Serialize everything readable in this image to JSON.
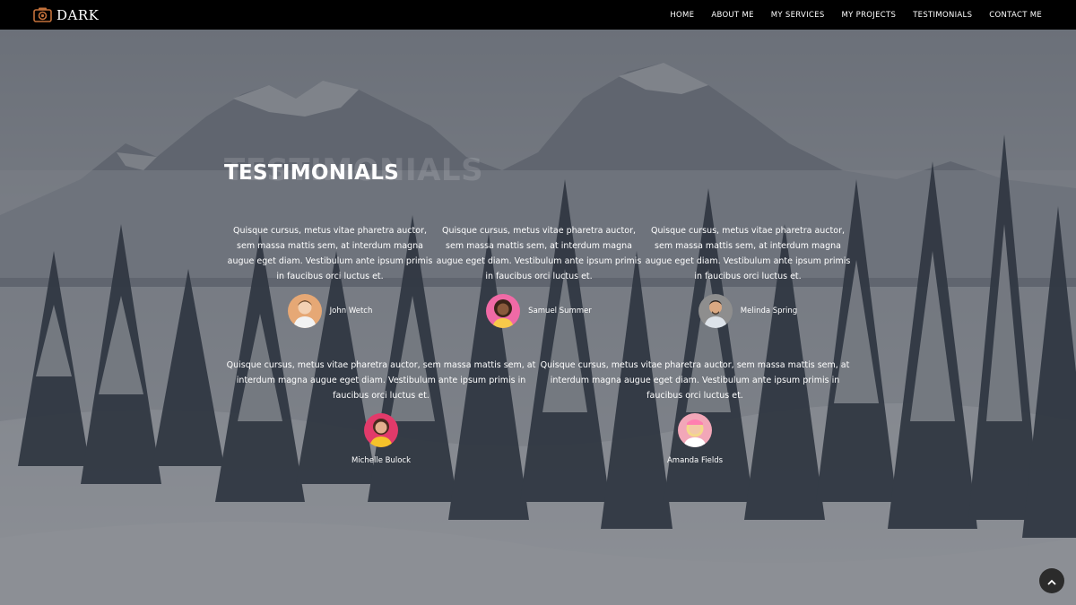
{
  "brand": {
    "name": "DARK",
    "icon": "camera-icon",
    "accent": "#c2703a"
  },
  "nav": {
    "items": [
      {
        "label": "HOME"
      },
      {
        "label": "ABOUT ME"
      },
      {
        "label": "MY SERVICES"
      },
      {
        "label": "MY PROJECTS"
      },
      {
        "label": "TESTIMONIALS"
      },
      {
        "label": "CONTACT ME"
      }
    ]
  },
  "testimonials": {
    "ghost_title": "TESTIMONIALS",
    "title": "TESTIMONIALS",
    "items": [
      {
        "quote": "Quisque cursus, metus vitae pharetra auctor, sem massa mattis sem, at interdum magna augue eget diam. Vestibulum ante ipsum primis in faucibus orci luctus et.",
        "name": "John Wetch",
        "avatar_bg": "#e6a875"
      },
      {
        "quote": "Quisque cursus, metus vitae pharetra auctor, sem massa mattis sem, at interdum magna augue eget diam. Vestibulum ante ipsum primis in faucibus orci luctus et.",
        "name": "Samuel Summer",
        "avatar_bg": "#f06aa6"
      },
      {
        "quote": "Quisque cursus, metus vitae pharetra auctor, sem massa mattis sem, at interdum magna augue eget diam. Vestibulum ante ipsum primis in faucibus orci luctus et.",
        "name": "Melinda Spring",
        "avatar_bg": "#8e8e8e"
      },
      {
        "quote": "Quisque cursus, metus vitae pharetra auctor, sem massa mattis sem, at interdum magna augue eget diam. Vestibulum ante ipsum primis in faucibus orci luctus et.",
        "name": "Michelle Bulock",
        "avatar_bg": "#e23a6a"
      },
      {
        "quote": "Quisque cursus, metus vitae pharetra auctor, sem massa mattis sem, at interdum magna augue eget diam. Vestibulum ante ipsum primis in faucibus orci luctus et.",
        "name": "Amanda Fields",
        "avatar_bg": "#f2a7b8"
      }
    ]
  },
  "back_to_top": {
    "icon": "chevron-up-icon"
  }
}
